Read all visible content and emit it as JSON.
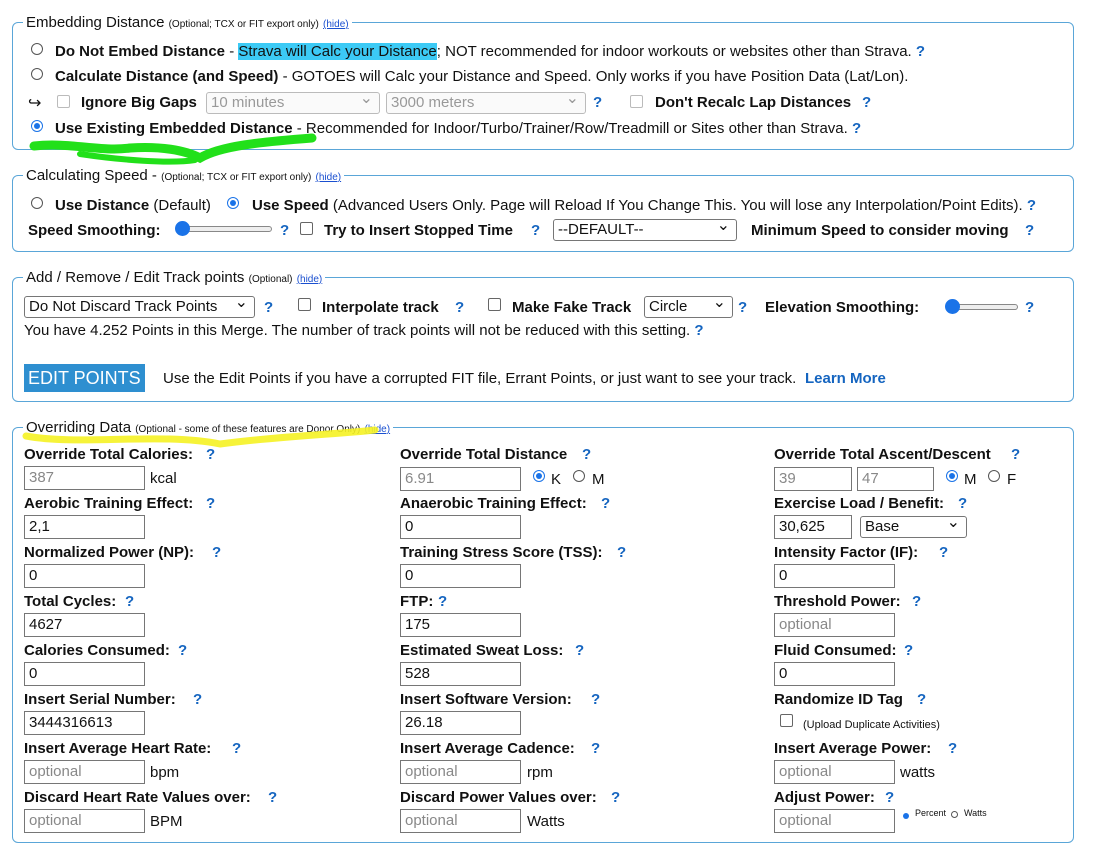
{
  "embed": {
    "legend": "Embedding Distance",
    "legend_note": "(Optional; TCX or FIT export only)",
    "hide": "(hide)",
    "opt1_label": "Do Not Embed Distance",
    "opt1_dash": " - ",
    "opt1_highlight": "Strava will Calc your Distance",
    "opt1_rest": "; NOT recommended for indoor workouts or websites other than Strava.",
    "opt2_label": "Calculate Distance (and Speed)",
    "opt2_rest": " - GOTOES will Calc your Distance and Speed. Only works if you have Position Data (Lat/Lon).",
    "arrow": "↪",
    "ignore_gaps": "Ignore Big Gaps",
    "gap_time": "10 minutes",
    "gap_dist": "3000 meters",
    "dont_recalc": "Don't Recalc Lap Distances",
    "opt3_label": "Use Existing Embedded Distance",
    "opt3_rest": " - Recommended for Indoor/Turbo/Trainer/Row/Treadmill or Sites other than Strava."
  },
  "speed": {
    "legend": "Calculating Speed",
    "legend_dash": " - ",
    "legend_note": "(Optional; TCX or FIT export only)",
    "hide": "(hide)",
    "use_distance": "Use Distance",
    "use_distance_note": " (Default)",
    "use_speed": "Use Speed",
    "use_speed_note": " (Advanced Users Only. Page will Reload If You Change This. You will lose any Interpolation/Point Edits).",
    "smoothing": "Speed Smoothing:",
    "stopped": "Try to Insert Stopped Time",
    "default_option": "--DEFAULT--",
    "min_speed": "Minimum Speed to consider moving"
  },
  "track": {
    "legend": "Add / Remove / Edit Track points",
    "legend_note": "(Optional)",
    "hide": "(hide)",
    "discard_select": "Do Not Discard Track Points",
    "interpolate": "Interpolate track",
    "fake_track": "Make Fake Track",
    "shape": "Circle",
    "elev_smoothing": "Elevation Smoothing:",
    "points_info": "You have 4.252 Points in this Merge. The number of track points will not be reduced with this setting.",
    "edit_button": "EDIT POINTS",
    "edit_info": "Use the Edit Points if you have a corrupted FIT file, Errant Points, or just want to see your track.",
    "learn_more": "Learn More"
  },
  "override": {
    "legend": "Overriding Data",
    "legend_note": "(Optional - some of these features are Donor Only)",
    "hide": "(hide)",
    "q": "?",
    "total_calories": "Override Total Calories:",
    "calories_ph": "387",
    "kcal": "kcal",
    "total_distance": "Override Total Distance",
    "distance_ph": "6.91",
    "k": "K",
    "m": "M",
    "ascent_descent": "Override Total Ascent/Descent",
    "ascent_ph": "39",
    "descent_ph": "47",
    "f": "F",
    "aerobic": "Aerobic Training Effect:",
    "aerobic_val": "2,1",
    "anaerobic": "Anaerobic Training Effect:",
    "anaerobic_val": "0",
    "exercise_load": "Exercise Load / Benefit:",
    "exercise_load_val": "30,625",
    "benefit": "Base",
    "np": "Normalized Power (NP):",
    "np_val": "0",
    "tss": "Training Stress Score (TSS):",
    "tss_val": "0",
    "if": "Intensity Factor (IF):",
    "if_val": "0",
    "cycles": "Total Cycles:",
    "cycles_val": "4627",
    "ftp": "FTP:",
    "ftp_val": "175",
    "threshold": "Threshold Power:",
    "optional": "optional",
    "cal_consumed": "Calories Consumed:",
    "cal_consumed_val": "0",
    "sweat": "Estimated Sweat Loss:",
    "sweat_val": "528",
    "fluid": "Fluid Consumed:",
    "fluid_val": "0",
    "serial": "Insert Serial Number:",
    "serial_val": "3444316613",
    "software": "Insert Software Version:",
    "software_val": "26.18",
    "randomize": "Randomize ID Tag",
    "upload_dup": "(Upload Duplicate Activities)",
    "avg_hr": "Insert Average Heart Rate:",
    "bpm": "bpm",
    "avg_cad": "Insert Average Cadence:",
    "rpm": "rpm",
    "avg_power": "Insert Average Power:",
    "watts": "watts",
    "discard_hr": "Discard Heart Rate Values over:",
    "bpm_caps": "BPM",
    "discard_power": "Discard Power Values over:",
    "watts_caps": "Watts",
    "adjust_power": "Adjust Power:",
    "percent": "Percent",
    "watts_small": "Watts"
  },
  "colors": {
    "accent": "#1a73e8",
    "border": "#5aa6d8",
    "green_mark": "#22e01a",
    "yellow_mark": "#f5f224",
    "blue_highlight": "#3ccaf5"
  }
}
